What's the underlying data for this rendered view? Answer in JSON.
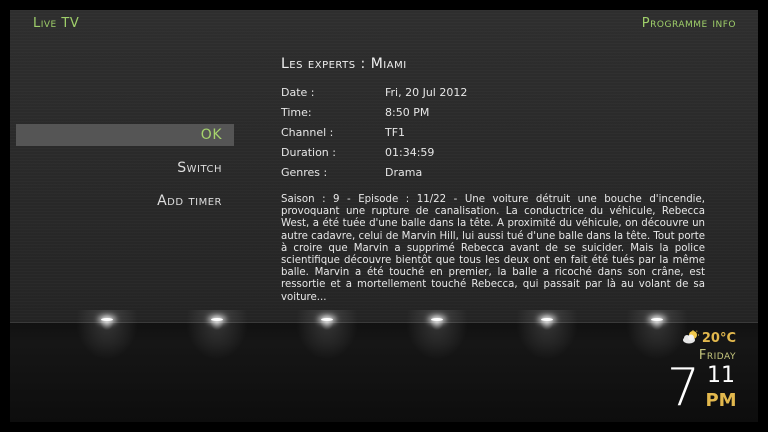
{
  "header": {
    "left": "Live TV",
    "right": "Programme info"
  },
  "menu": [
    {
      "label": "OK",
      "selected": true
    },
    {
      "label": "Switch",
      "selected": false
    },
    {
      "label": "Add timer",
      "selected": false
    }
  ],
  "program": {
    "title": "Les experts : Miami",
    "fields": [
      {
        "label": "Date :",
        "value": "Fri, 20 Jul 2012"
      },
      {
        "label": "Time:",
        "value": "8:50 PM"
      },
      {
        "label": "Channel :",
        "value": "TF1"
      },
      {
        "label": "Duration :",
        "value": "01:34:59"
      },
      {
        "label": "Genres :",
        "value": "Drama"
      }
    ],
    "description": "Saison : 9 - Episode : 11/22 - Une voiture détruit une bouche d'incendie, provoquant une rupture de canalisation. La conductrice du véhicule, Rebecca West, a été tuée d'une balle dans la tête. A proximité du véhicule, on découvre un autre cadavre, celui de Marvin Hill, lui aussi tué d'une balle dans la tête. Tout porte à croire que Marvin a supprimé Rebecca avant de se suicider. Mais la police scientifique découvre bientôt que tous les deux ont en fait été tués par la même balle. Marvin a été touché en premier, la balle a ricoché dans son crâne, est ressortie et a mortellement touché Rebecca, qui passait par là au volant de sa voiture..."
  },
  "weather": {
    "icon": "partly-cloudy-icon",
    "temp": "20°C",
    "day": "Friday"
  },
  "clock": {
    "hour": "7",
    "minute": "11",
    "ampm": "PM"
  },
  "colors": {
    "accent": "#9fcf6a",
    "highlight": "#e2b84d",
    "selection_bg": "#555555"
  }
}
